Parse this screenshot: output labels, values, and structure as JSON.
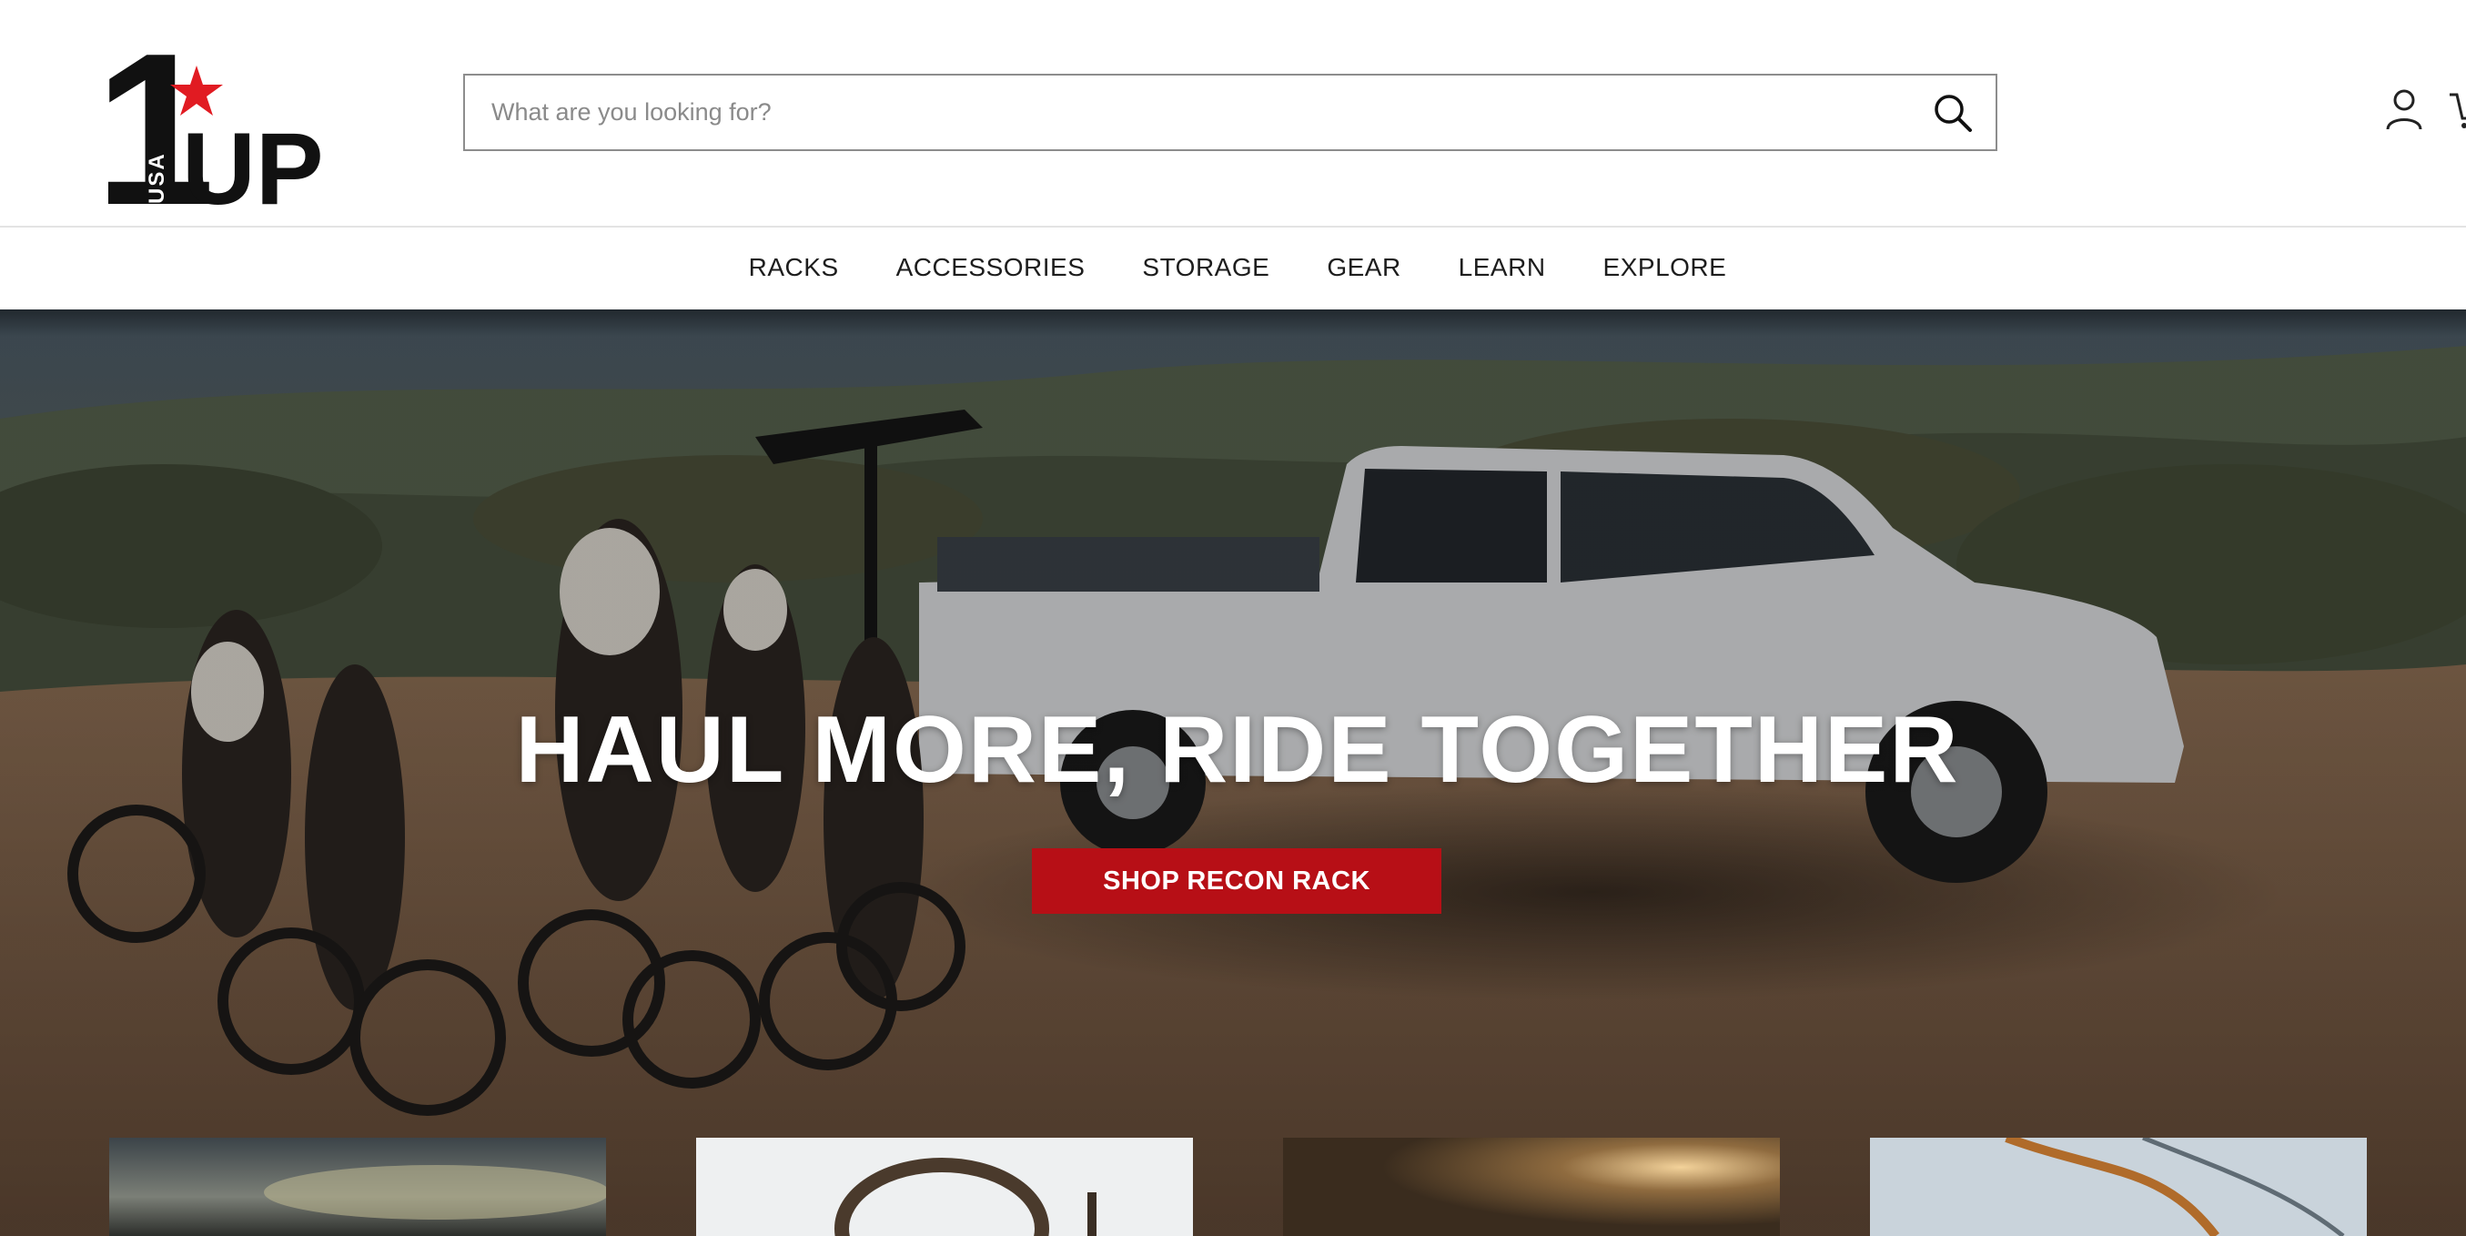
{
  "header": {
    "logo": {
      "number": "1",
      "word": "UP",
      "country": "USA",
      "star_color": "#e11b22"
    },
    "search": {
      "placeholder": "What are you looking for?",
      "value": "",
      "icon": "search-icon"
    },
    "account_icon": "user-icon",
    "cart_icon": "cart-icon"
  },
  "nav": {
    "items": [
      {
        "label": "RACKS"
      },
      {
        "label": "ACCESSORIES"
      },
      {
        "label": "STORAGE"
      },
      {
        "label": "GEAR"
      },
      {
        "label": "LEARN"
      },
      {
        "label": "EXPLORE"
      }
    ]
  },
  "hero": {
    "title": "HAUL MORE, RIDE TOGETHER",
    "cta_label": "SHOP RECON RACK",
    "cta_color": "#b70f16"
  },
  "cards": [
    {
      "name": "card-1"
    },
    {
      "name": "card-2"
    },
    {
      "name": "card-3"
    },
    {
      "name": "card-4"
    }
  ],
  "colors": {
    "accent": "#b70f16",
    "text": "#1d1d1d",
    "border": "#8d8d8d"
  }
}
